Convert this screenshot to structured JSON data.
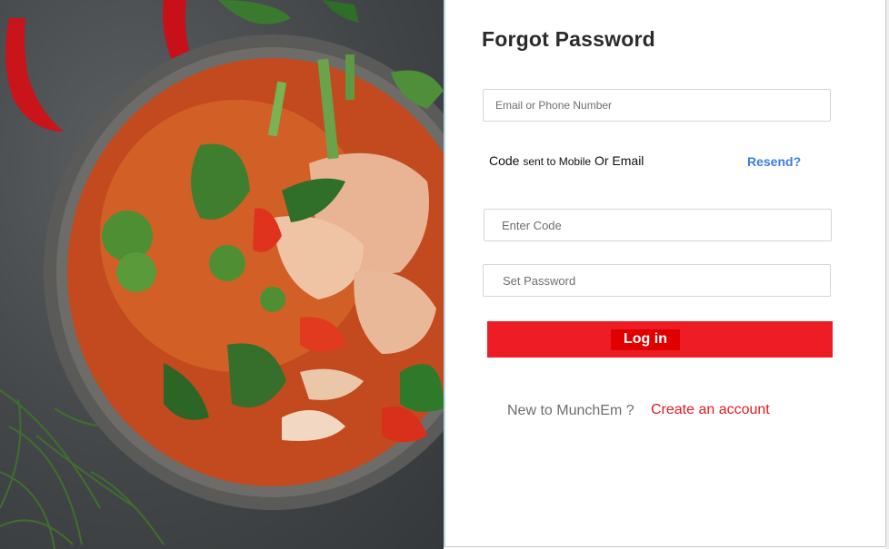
{
  "hero": {
    "image": "thai-curry-soup-photo"
  },
  "form": {
    "title": "Forgot Password",
    "email_placeholder": "Email or Phone Number",
    "code_sent_prefix": "Code",
    "code_sent_middle": "sent to Mobile",
    "code_sent_suffix": "Or Email",
    "resend_label": "Resend?",
    "code_placeholder": "Enter Code",
    "password_placeholder": "Set Password",
    "login_label": "Log in",
    "signup_question": "New to MunchEm ?",
    "signup_link": "Create an account"
  },
  "colors": {
    "brand_red": "#ee1c25",
    "link_blue": "#3a7fe0",
    "link_red": "#e41b23"
  }
}
